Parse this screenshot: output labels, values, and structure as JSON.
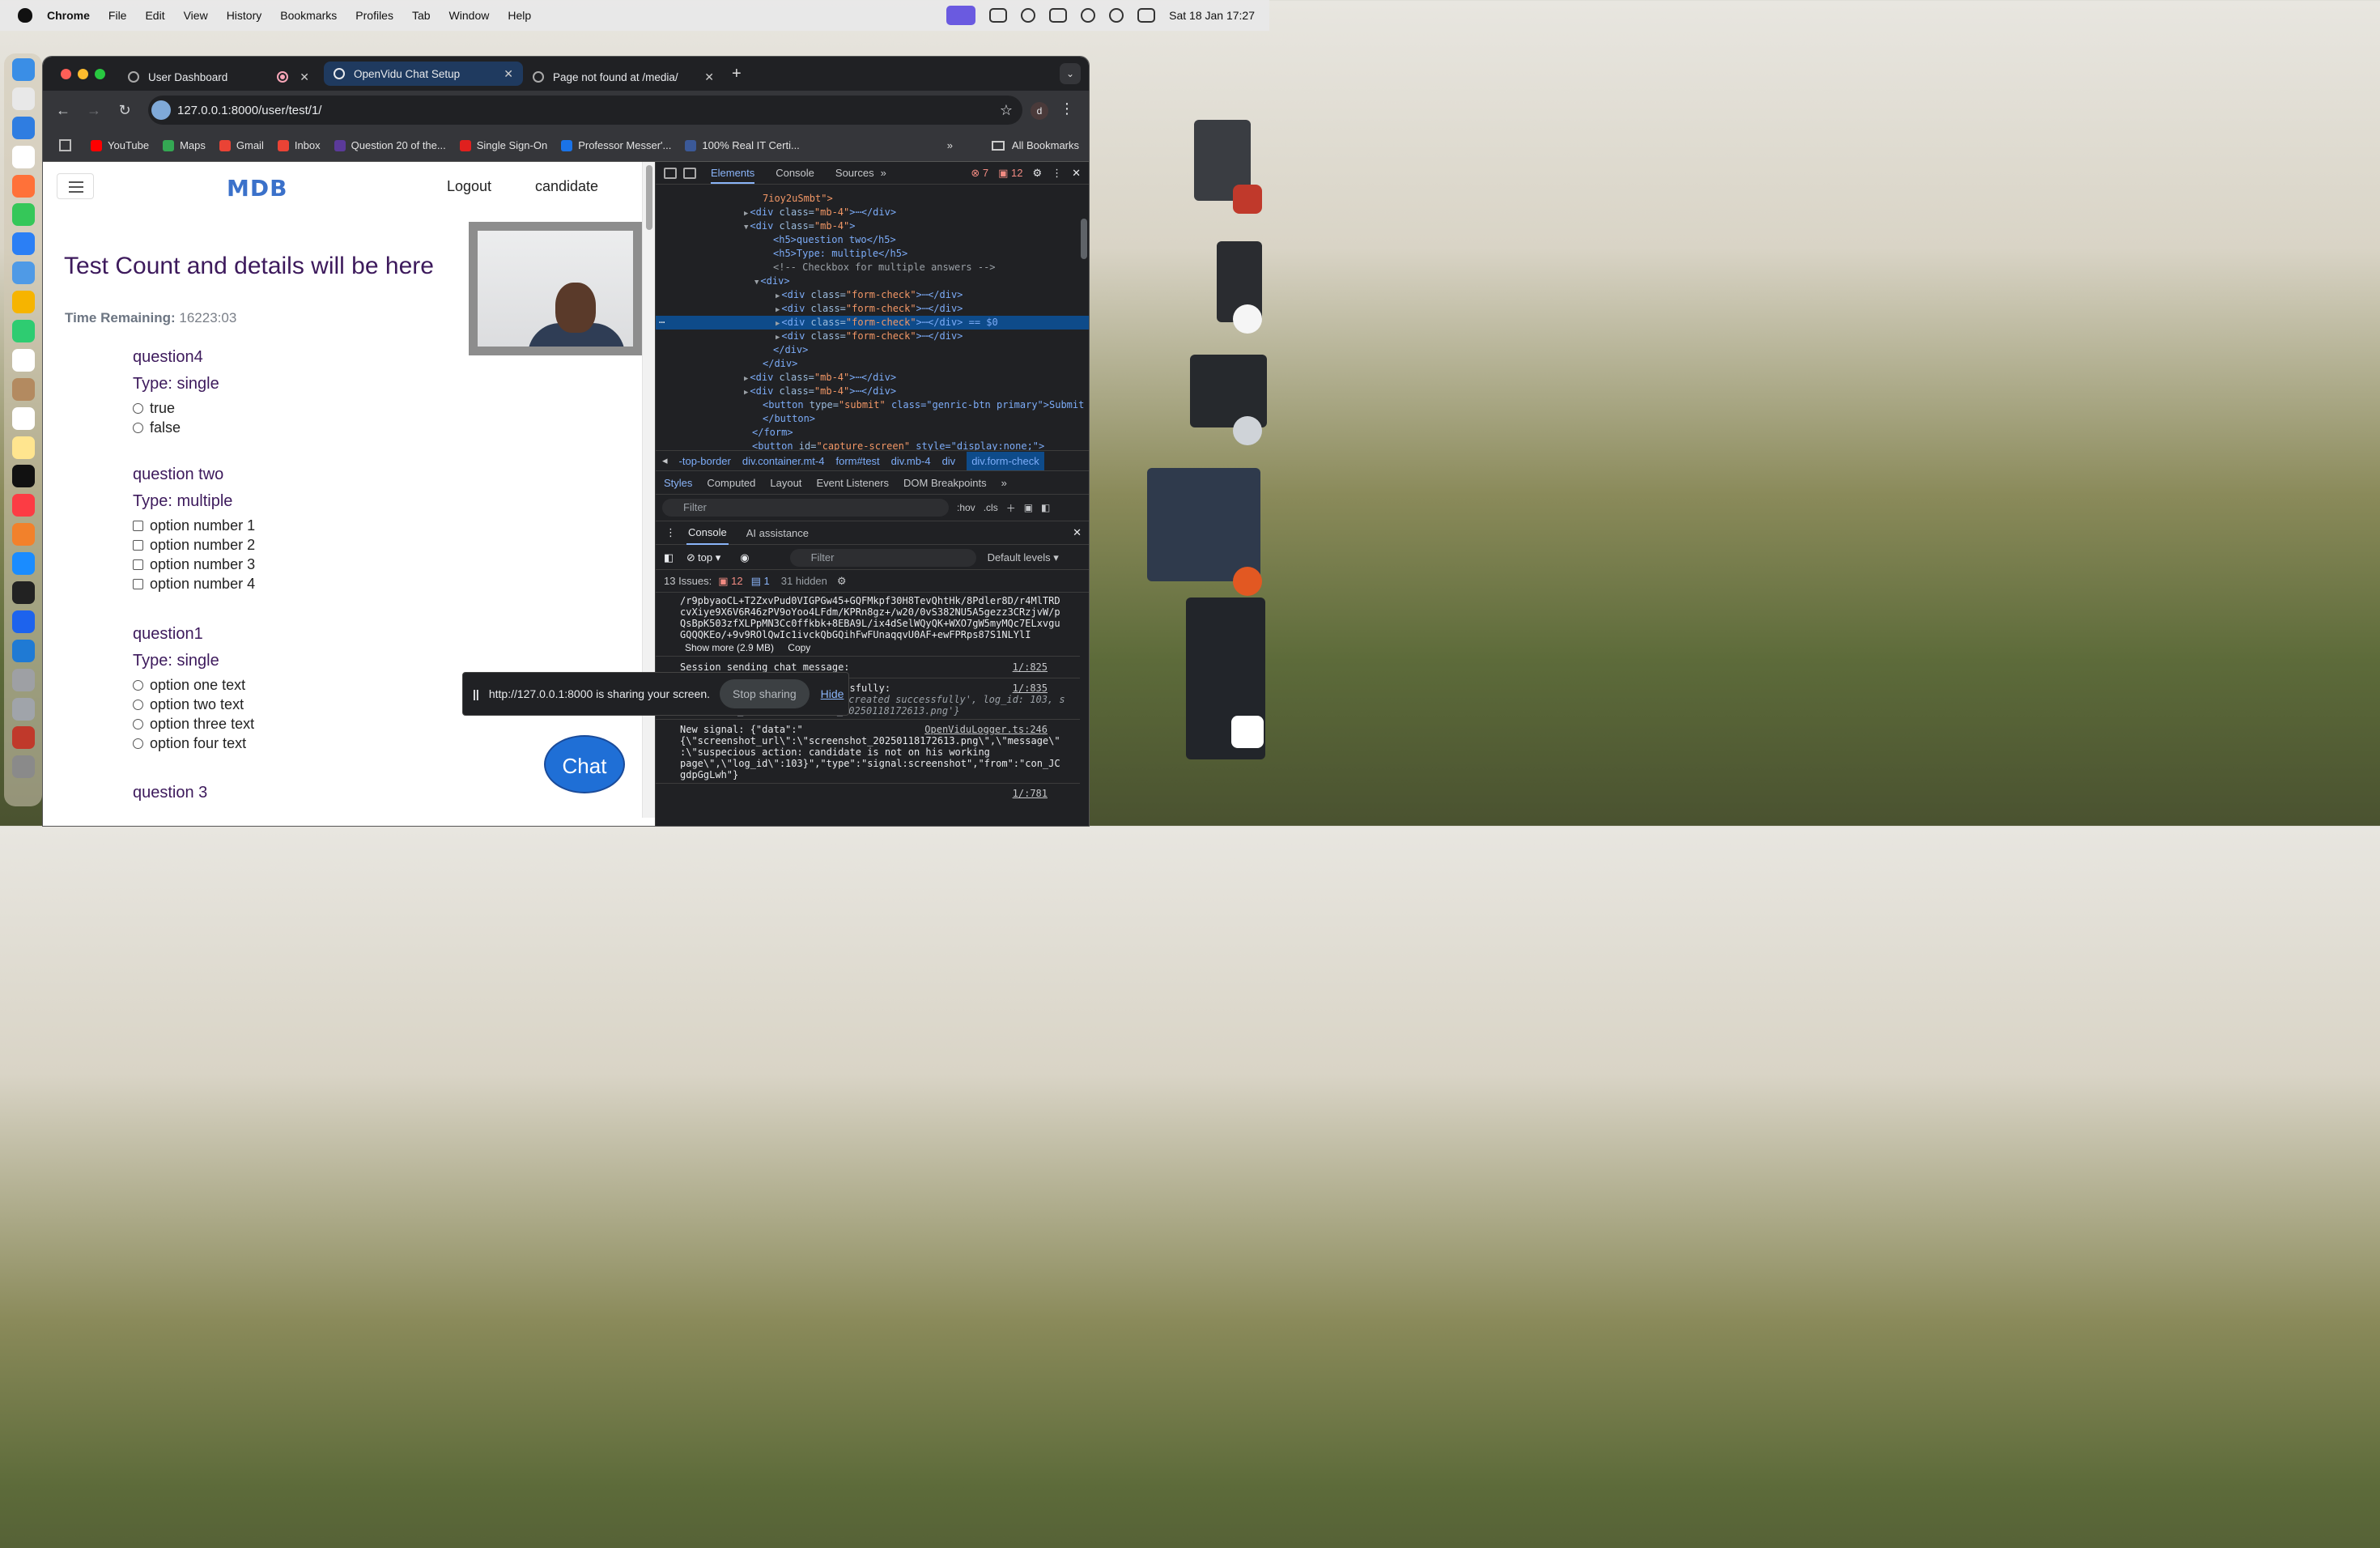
{
  "menubar": {
    "app": "Chrome",
    "items": [
      "File",
      "Edit",
      "View",
      "History",
      "Bookmarks",
      "Profiles",
      "Tab",
      "Window",
      "Help"
    ],
    "clock": "Sat 18 Jan  17:27"
  },
  "browser": {
    "tabs": [
      {
        "title": "User Dashboard"
      },
      {
        "title": "OpenVidu Chat Setup"
      },
      {
        "title": "Page not found at /media/"
      }
    ],
    "url": "127.0.0.1:8000/user/test/1/",
    "profile_initial": "d",
    "bookmarks": [
      {
        "label": "YouTube",
        "color": "#ff0000"
      },
      {
        "label": "Maps",
        "color": "#34a853"
      },
      {
        "label": "Gmail",
        "color": "#ea4335"
      },
      {
        "label": "Inbox",
        "color": "#ea4335"
      },
      {
        "label": "Question 20 of the...",
        "color": "#5b3a9a"
      },
      {
        "label": "Single Sign-On",
        "color": "#e0201e"
      },
      {
        "label": "Professor Messer'...",
        "color": "#1a73e8"
      },
      {
        "label": "100% Real IT Certi...",
        "color": "#3b5998"
      }
    ],
    "all_bookmarks": "All Bookmarks"
  },
  "page": {
    "logo": "MDB",
    "logout": "Logout",
    "user": "candidate",
    "hero": "Test Count and details will be here",
    "time_label": "Time Remaining:",
    "time_value": "16223:03",
    "questions": [
      {
        "title": "question4",
        "type": "Type: single",
        "kind": "radio",
        "options": [
          "true",
          "false"
        ]
      },
      {
        "title": "question two",
        "type": "Type: multiple",
        "kind": "check",
        "options": [
          "option number 1",
          "option number 2",
          "option number 3",
          "option number 4"
        ]
      },
      {
        "title": "question1",
        "type": "Type: single",
        "kind": "radio",
        "options": [
          "option one text",
          "option two text",
          "option three text",
          "option four text"
        ]
      },
      {
        "title": "question 3"
      }
    ],
    "chat": "Chat",
    "share_text": "http://127.0.0.1:8000 is sharing your screen.",
    "stop_sharing": "Stop sharing",
    "hide": "Hide"
  },
  "devtools": {
    "tabs": [
      "Elements",
      "Console",
      "Sources"
    ],
    "errors": "7",
    "warnings": "12",
    "dom_lines": [
      {
        "indent": 10,
        "text": "7ioy2uSmbt\">",
        "kind": "attrv"
      },
      {
        "indent": 9,
        "arrow": "▶",
        "tag": "<div ",
        "attr": "class=",
        "val": "\"mb-4\"",
        "rest": ">⋯</div>"
      },
      {
        "indent": 9,
        "arrow": "▼",
        "tag": "<div ",
        "attr": "class=",
        "val": "\"mb-4\"",
        "rest": ">"
      },
      {
        "indent": 11,
        "tag": "<h5>",
        "rest": "question two</h5>"
      },
      {
        "indent": 11,
        "tag": "<h5>",
        "rest": "Type: multiple</h5>"
      },
      {
        "indent": 11,
        "comment": "<!-- Checkbox for multiple answers -->"
      },
      {
        "indent": 10,
        "arrow": "▼",
        "tag": "<div>",
        "rest": ""
      },
      {
        "indent": 12,
        "arrow": "▶",
        "tag": "<div ",
        "attr": "class=",
        "val": "\"form-check\"",
        "rest": ">⋯</div>"
      },
      {
        "indent": 12,
        "arrow": "▶",
        "tag": "<div ",
        "attr": "class=",
        "val": "\"form-check\"",
        "rest": ">⋯</div>"
      },
      {
        "indent": 12,
        "arrow": "▶",
        "tag": "<div ",
        "attr": "class=",
        "val": "\"form-check\"",
        "rest": ">⋯</div> == $0",
        "selected": true
      },
      {
        "indent": 12,
        "arrow": "▶",
        "tag": "<div ",
        "attr": "class=",
        "val": "\"form-check\"",
        "rest": ">⋯</div>"
      },
      {
        "indent": 11,
        "tag": "</div>",
        "rest": ""
      },
      {
        "indent": 10,
        "tag": "</div>",
        "rest": ""
      },
      {
        "indent": 9,
        "arrow": "▶",
        "tag": "<div ",
        "attr": "class=",
        "val": "\"mb-4\"",
        "rest": ">⋯</div>"
      },
      {
        "indent": 9,
        "arrow": "▶",
        "tag": "<div ",
        "attr": "class=",
        "val": "\"mb-4\"",
        "rest": ">⋯</div>"
      },
      {
        "indent": 10,
        "tag": "<button ",
        "attr": "type=",
        "val": "\"submit\"",
        "rest": " class=\"genric-btn primary\">Submit"
      },
      {
        "indent": 10,
        "tag": "</button>",
        "rest": ""
      },
      {
        "indent": 9,
        "tag": "</form>",
        "rest": ""
      },
      {
        "indent": 9,
        "tag": "<button ",
        "attr": "id=",
        "val": "\"capture-screen\"",
        "rest": " style=\"display:none;\">"
      }
    ],
    "crumbs": [
      "-top-border",
      "div.container.mt-4",
      "form#test",
      "div.mb-4",
      "div",
      "div.form-check"
    ],
    "sub_tabs": [
      "Styles",
      "Computed",
      "Layout",
      "Event Listeners",
      "DOM Breakpoints"
    ],
    "filter": "Filter",
    "hov": ":hov",
    "cls": ".cls",
    "console_tab": "Console",
    "ai_tab": "AI assistance",
    "context": "top",
    "console_filter": "Filter",
    "levels": "Default levels",
    "issues_label": "13 Issues:",
    "issues_errors": "12",
    "issues_info": "1",
    "hidden": "31 hidden",
    "log": {
      "base64": [
        "/r9pbyaoCL+T2ZxvPud0VIGPGw45+GQFMkpf30H8TevQhtHk/8Pdler8D/r4MlTRD",
        "cvXiye9X6V6R46zPV9oYoo4LFdm/KPRn8gz+/w20/0vS382NU5A5gezz3CRzjvW/p",
        "QsBpK503zfXLPpMN3Cc0ffkbk+8EBA9L/ix4dSelWQyQK+WXO7gW5myMQc7ELxvgu",
        "GQQQKEo/+9v9ROlQwIc1ivckQbGQihFwFUnaqqvU0AF+ewFPRps87S1NLYlI"
      ],
      "show_more": "Show more (2.9 MB)",
      "copy": "Copy",
      "session": "Session sending chat message:",
      "session_src": "1/:825",
      "monitor": "Monitoring log created successfully:",
      "monitor_src": "1/:835",
      "monitor_obj_1": "{message: 'Monitoring log created successfully', log_id: 103, s",
      "monitor_obj_2": "creenshot_url: 'screenshot_20250118172613.png'}",
      "signal": "New signal: {\"data\":\"",
      "signal_src": "OpenViduLogger.ts:246",
      "signal_lines": [
        "{\\\"screenshot_url\\\":\\\"screenshot_20250118172613.png\\\",\\\"message\\\"",
        ":\\\"suspecious action: candidate is not on his working",
        "page\\\",\\\"log_id\\\":103}\",\"type\":\"signal:screenshot\",\"from\":\"con_JC",
        "gdpGgLwh\"}"
      ],
      "last_src": "1/:781"
    }
  }
}
